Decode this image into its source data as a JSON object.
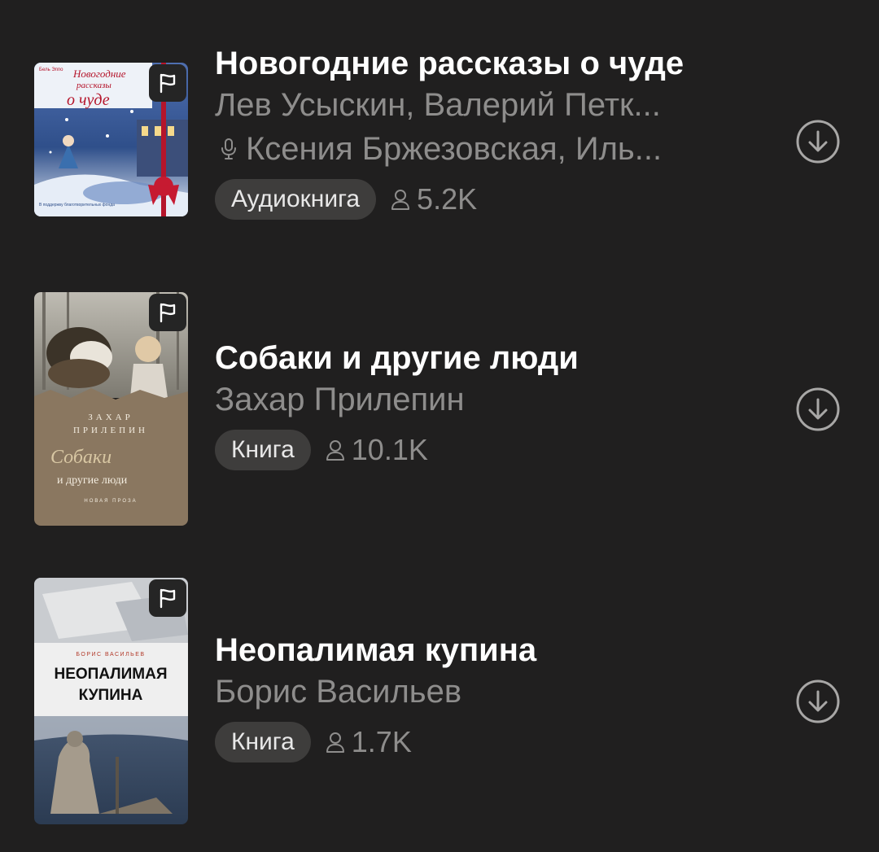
{
  "books": [
    {
      "title": "Новогодние рассказы о чуде",
      "authors": "Лев Усыскин, Валерий Петк...",
      "narrators": "Ксения Бржезовская, Иль...",
      "type": "Аудиокнига",
      "listeners": "5.2K",
      "cover": {
        "icon": "flag-icon",
        "publisher": "Бель Эппо",
        "title_line1": "Новогодние",
        "title_line2": "рассказы",
        "title_line3": "о чуде",
        "footer": "В поддержку благотворительных фонда",
        "colors": {
          "sky": "#2f4f8a",
          "snow": "#dfe7f3",
          "ribbon": "#b5152b"
        }
      }
    },
    {
      "title": "Собаки и другие люди",
      "authors": "Захар Прилепин",
      "type": "Книга",
      "listeners": "10.1K",
      "cover": {
        "icon": "flag-icon",
        "author_line1": "ЗАХАР",
        "author_line2": "ПРИЛЕПИН",
        "title_script": "Собаки",
        "title_rest": "и другие люди",
        "series": "НОВАЯ ПРОЗА",
        "colors": {
          "panel": "#8a7760",
          "script": "#d8c7a3"
        }
      }
    },
    {
      "title": "Неопалимая купина",
      "authors": "Борис Васильев",
      "type": "Книга",
      "listeners": "1.7K",
      "cover": {
        "icon": "flag-icon",
        "author": "БОРИС ВАСИЛЬЕВ",
        "title_line1": "НЕОПАЛИМАЯ",
        "title_line2": "КУПИНА",
        "colors": {
          "band": "#efefef",
          "bottom": "#2b3b52",
          "author": "#b23a2a"
        }
      }
    }
  ],
  "icons": {
    "download": "download-circle-icon",
    "listeners": "person-icon",
    "narrator": "microphone-icon"
  }
}
